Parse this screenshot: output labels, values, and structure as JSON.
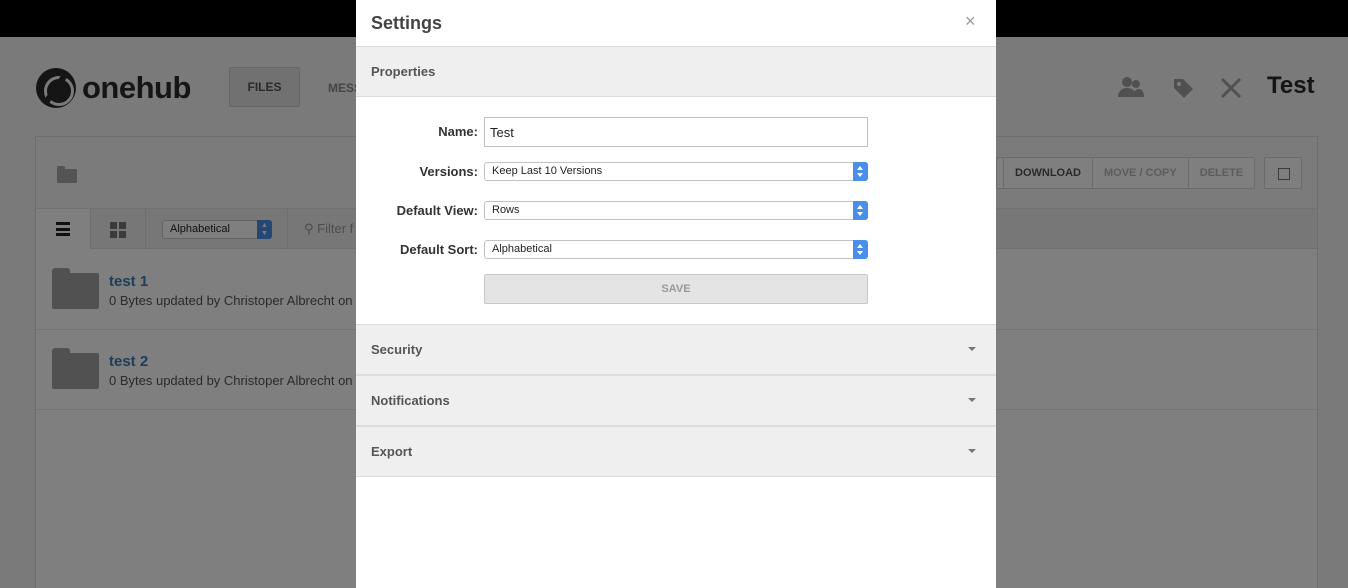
{
  "app": {
    "logo_text": "onehub",
    "nav": {
      "files": "FILES",
      "messages_partial": "MESS"
    },
    "header_icons": [
      "users-icon",
      "tag-icon",
      "tools-icon"
    ],
    "workspace_title": "Test",
    "actions": [
      "DOWNLOAD",
      "MOVE / COPY",
      "DELETE"
    ],
    "sort_value": "Alphabetical",
    "filter_placeholder": "Filter f",
    "rows": [
      {
        "name": "test 1",
        "meta": "0 Bytes updated by Christoper Albrecht on"
      },
      {
        "name": "test 2",
        "meta": "0 Bytes updated by Christoper Albrecht on"
      }
    ]
  },
  "modal": {
    "title": "Settings",
    "close": "×",
    "properties": {
      "label": "Properties",
      "name_label": "Name:",
      "name_value": "Test",
      "versions_label": "Versions:",
      "versions_value": "Keep Last 10 Versions",
      "default_view_label": "Default View:",
      "default_view_value": "Rows",
      "default_sort_label": "Default Sort:",
      "default_sort_value": "Alphabetical",
      "save_label": "SAVE"
    },
    "sections": [
      "Security",
      "Notifications",
      "Export"
    ]
  },
  "colors": {
    "accent": "#4a8fe7",
    "link": "#3a7bb7",
    "overlay": "rgba(0,0,0,0.5)"
  }
}
